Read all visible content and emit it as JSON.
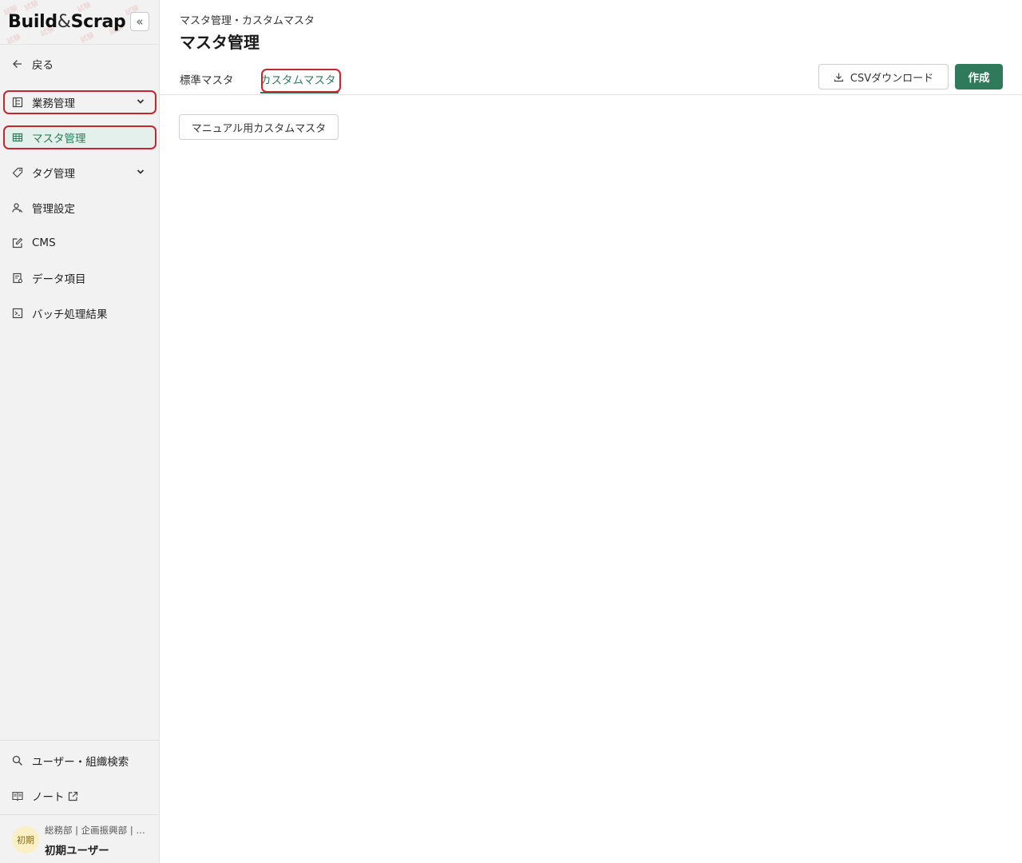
{
  "sidebar": {
    "logo": {
      "part1": "Build",
      "amp": "&",
      "part2": "Scrap",
      "watermark": "試験"
    },
    "collapse_symbol": "«",
    "back_label": "戻る",
    "items": [
      {
        "label": "業務管理",
        "icon": "business-icon"
      },
      {
        "label": "マスタ管理",
        "icon": "table-icon"
      },
      {
        "label": "タグ管理",
        "icon": "tag-icon"
      },
      {
        "label": "管理設定",
        "icon": "admin-users-icon"
      },
      {
        "label": "CMS",
        "icon": "edit-icon"
      },
      {
        "label": "データ項目",
        "icon": "data-item-icon"
      },
      {
        "label": "バッチ処理結果",
        "icon": "terminal-icon"
      }
    ],
    "bottom": [
      {
        "label": "ユーザー・組織検索",
        "icon": "search-icon"
      },
      {
        "label": "ノート",
        "icon": "book-icon",
        "trailing_icon": "external-link-icon"
      }
    ],
    "user": {
      "avatar_text": "初期",
      "org": "総務部 | 企画振興部 | …",
      "name": "初期ユーザー"
    }
  },
  "header": {
    "breadcrumb": "マスタ管理・カスタムマスタ",
    "title": "マスタ管理",
    "tabs": [
      {
        "label": "標準マスタ",
        "active": false
      },
      {
        "label": "カスタムマスタ",
        "active": true
      }
    ],
    "csv_button": "CSVダウンロード",
    "create_button": "作成"
  },
  "content": {
    "masters": [
      "マニュアル用カスタムマスタ"
    ]
  },
  "colors": {
    "accent": "#2f7a5a",
    "highlight": "#c6262d",
    "active_bg": "#e3f0eb"
  }
}
